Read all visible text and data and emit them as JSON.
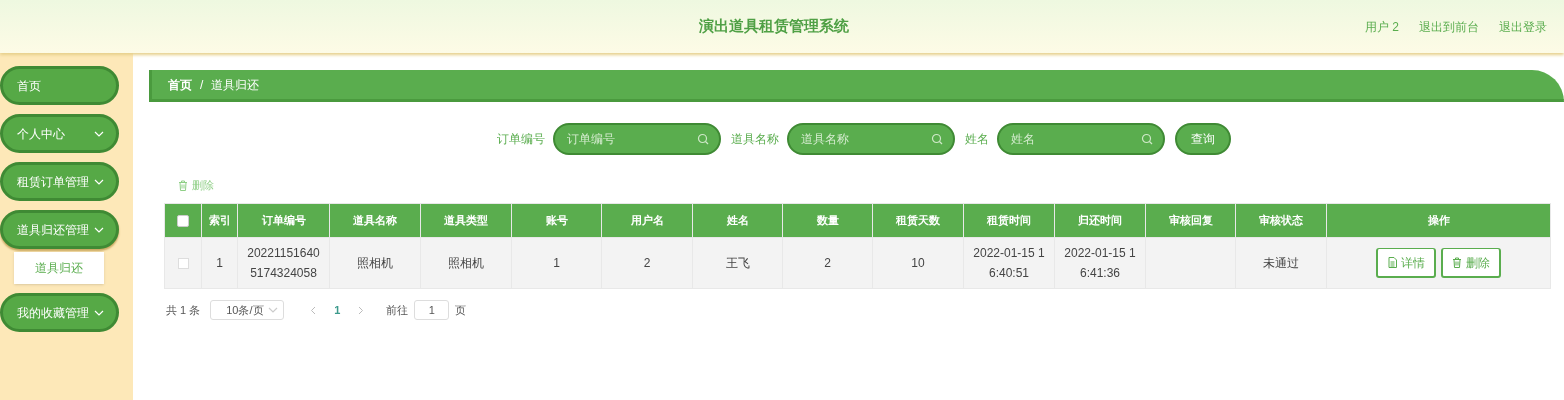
{
  "header": {
    "title": "演出道具租赁管理系统",
    "links": [
      "用户 2",
      "退出到前台",
      "退出登录"
    ]
  },
  "sidebar": {
    "items": [
      {
        "label": "首页",
        "kind": "link"
      },
      {
        "label": "个人中心",
        "kind": "group",
        "expanded": false
      },
      {
        "label": "租赁订单管理",
        "kind": "group",
        "expanded": false
      },
      {
        "label": "道具归还管理",
        "kind": "group",
        "expanded": true,
        "children": [
          {
            "label": "道具归还"
          }
        ]
      },
      {
        "label": "我的收藏管理",
        "kind": "group",
        "expanded": false
      }
    ]
  },
  "breadcrumb": [
    "首页",
    "道具归还"
  ],
  "breadcrumb_separator": "/",
  "search": {
    "fields": [
      {
        "label": "订单编号",
        "placeholder": "订单编号"
      },
      {
        "label": "道具名称",
        "placeholder": "道具名称"
      },
      {
        "label": "姓名",
        "placeholder": "姓名"
      }
    ],
    "button": "查询"
  },
  "toolbar": {
    "delete": "删除"
  },
  "table": {
    "select_all": {
      "checked": false
    },
    "columns": [
      "索引",
      "订单编号",
      "道具名称",
      "道具类型",
      "账号",
      "用户名",
      "姓名",
      "数量",
      "租赁天数",
      "租赁时间",
      "归还时间",
      "审核回复",
      "审核状态",
      "操作"
    ],
    "rows": [
      {
        "checked": false,
        "cells": [
          "1",
          "202211516405174324058",
          "照相机",
          "照相机",
          "1",
          "2",
          "王飞",
          "2",
          "10",
          "2022-01-15 16:40:51",
          "2022-01-15 16:41:36",
          "",
          "未通过"
        ],
        "actions": [
          "详情",
          "删除"
        ]
      }
    ]
  },
  "pagination": {
    "total": "共 1 条",
    "page_size": "10条/页",
    "pages": [
      {
        "label": "1",
        "selected": true
      }
    ],
    "goto_label": "前往",
    "goto_value": "1",
    "goto_unit": "页"
  }
}
